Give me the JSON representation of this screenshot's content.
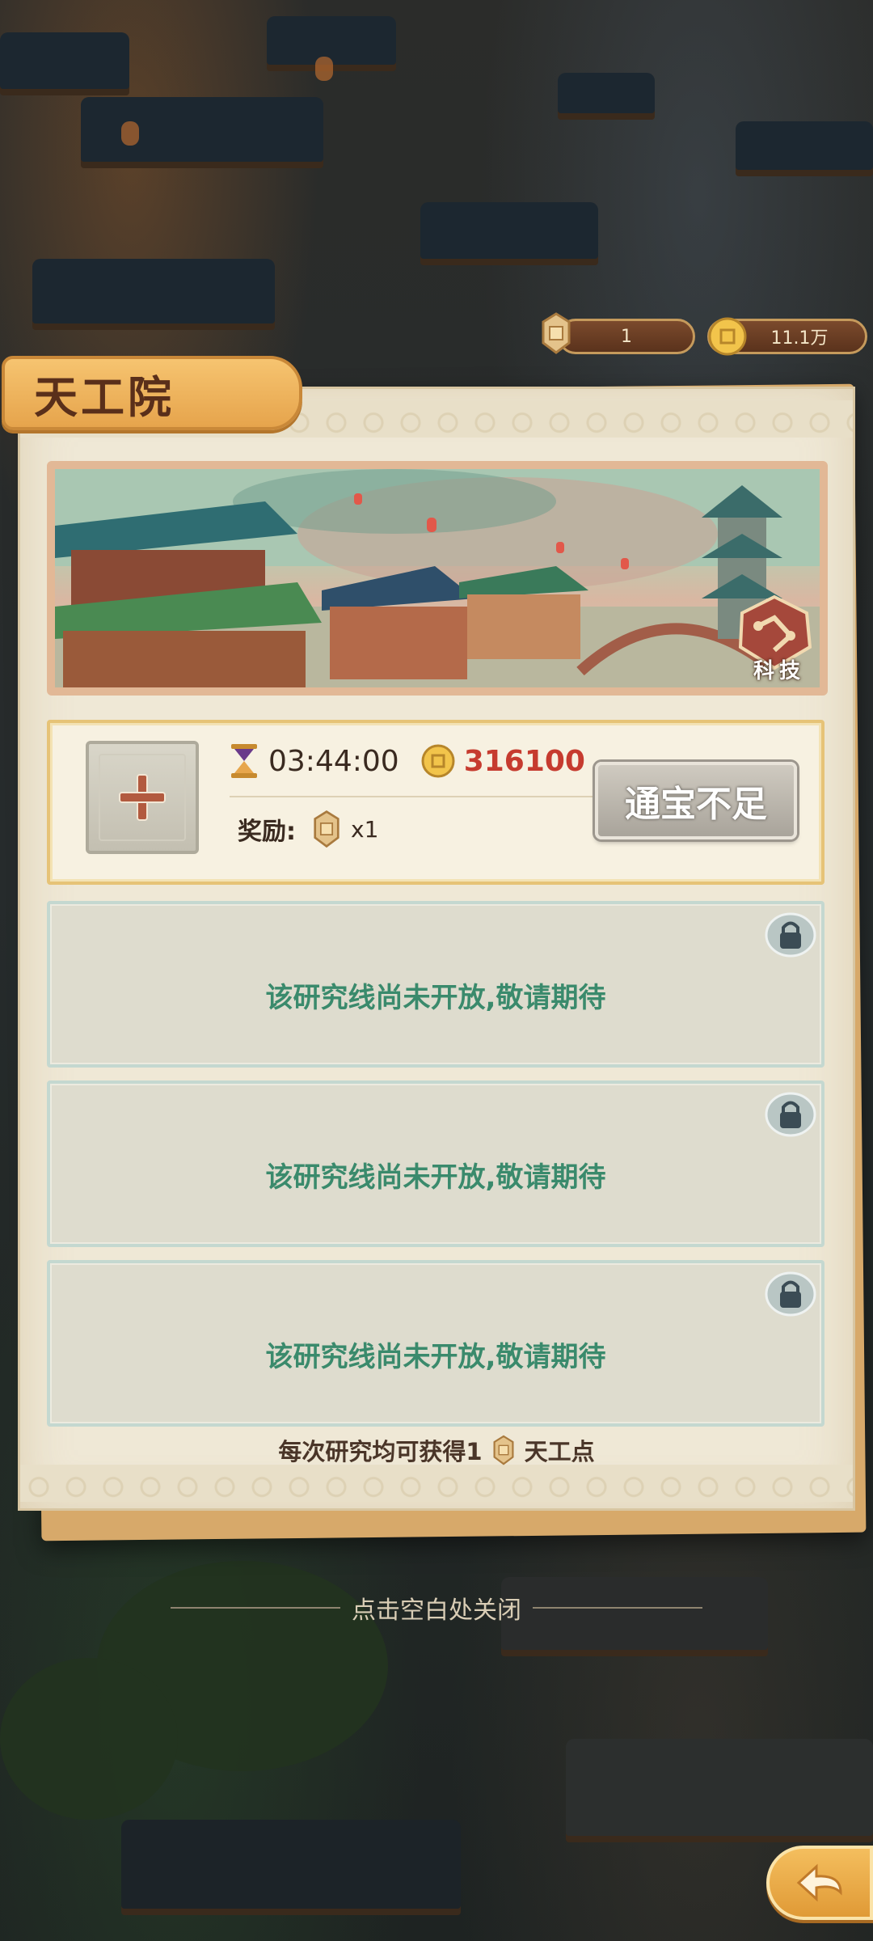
{
  "resources": {
    "tiangong_points": "1",
    "coins": "11.1万"
  },
  "panel": {
    "title": "天工院",
    "banner_tag": "科技"
  },
  "active_research": {
    "timer": "03:44:00",
    "cost": "316100",
    "reward_label": "奖励:",
    "reward_multiplier": "x1",
    "action_button": "通宝不足"
  },
  "locked_lines": [
    {
      "text": "该研究线尚未开放,敬请期待"
    },
    {
      "text": "该研究线尚未开放,敬请期待"
    },
    {
      "text": "该研究线尚未开放,敬请期待"
    }
  ],
  "footer": {
    "note_prefix": "每次研究均可获得1",
    "note_suffix": "天工点"
  },
  "close_hint": "点击空白处关闭",
  "colors": {
    "accent": "#e6a44c",
    "cost_red": "#c63b2f",
    "locked_green": "#3a8a6c"
  },
  "icons": [
    "puzzle-piece-icon",
    "copper-coin-icon",
    "hourglass-icon",
    "plus-icon",
    "lock-icon",
    "back-arrow-icon"
  ]
}
